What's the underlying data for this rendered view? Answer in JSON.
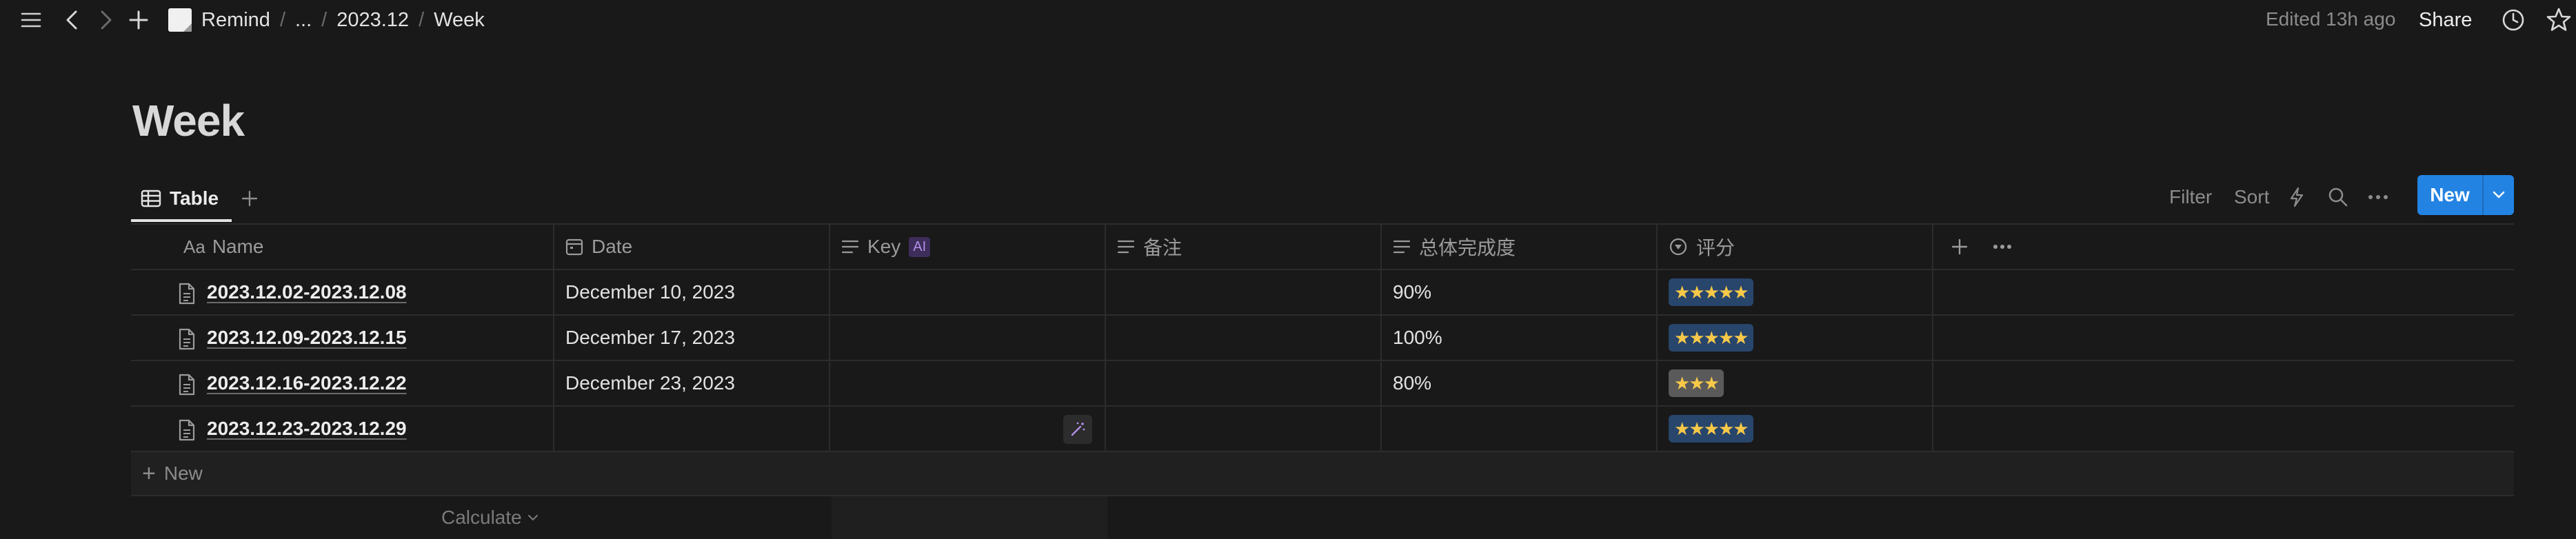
{
  "topbar": {
    "breadcrumb": [
      "Remind",
      "...",
      "2023.12",
      "Week"
    ],
    "edited": "Edited 13h ago",
    "share": "Share"
  },
  "page": {
    "title": "Week"
  },
  "views": {
    "active_tab": "Table",
    "filter": "Filter",
    "sort": "Sort",
    "new_button": "New"
  },
  "table": {
    "columns": {
      "name": "Name",
      "name_prefix": "Aa",
      "date": "Date",
      "key": "Key",
      "key_badge": "AI",
      "note": "备注",
      "completion": "总体完成度",
      "rating": "评分"
    },
    "rows": [
      {
        "name": "2023.12.02-2023.12.08",
        "date": "December 10, 2023",
        "completion": "90%",
        "stars": 5,
        "rating_color": "blue"
      },
      {
        "name": "2023.12.09-2023.12.15",
        "date": "December 17, 2023",
        "completion": "100%",
        "stars": 5,
        "rating_color": "blue"
      },
      {
        "name": "2023.12.16-2023.12.22",
        "date": "December 23, 2023",
        "completion": "80%",
        "stars": 3,
        "rating_color": "grey"
      },
      {
        "name": "2023.12.23-2023.12.29",
        "date": "",
        "completion": "",
        "stars": 5,
        "rating_color": "blue"
      }
    ],
    "new_row": "New",
    "calculate": "Calculate"
  },
  "colors": {
    "background": "#191919",
    "accent": "#2383e2",
    "rating_blue": "#28456c",
    "rating_grey": "#5a5a5a",
    "star": "#f7c948"
  }
}
